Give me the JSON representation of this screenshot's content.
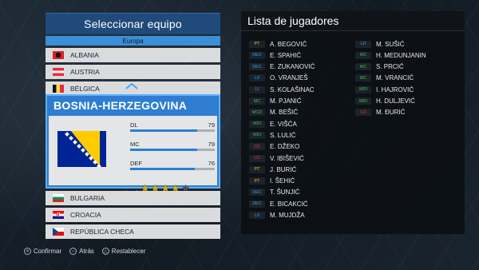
{
  "left_panel": {
    "title": "Seleccionar equipo",
    "region": "Europa",
    "countries_top": [
      "ALBANIA",
      "AUSTRIA",
      "BÉLGICA"
    ],
    "selected": {
      "name": "BOSNIA-HERZEGOVINA",
      "stats": [
        {
          "label": "DL",
          "value": "79",
          "fill": 79
        },
        {
          "label": "MC",
          "value": "79",
          "fill": 79
        },
        {
          "label": "DEF",
          "value": "76",
          "fill": 76
        }
      ],
      "stars": 4,
      "stars_max": 5
    },
    "countries_bottom": [
      "BULGARIA",
      "CROACIA",
      "REPÚBLICA CHECA"
    ]
  },
  "legend": {
    "confirm": "Confirmar",
    "back": "Atrás",
    "reset": "Restablecer"
  },
  "right_panel": {
    "title": "Lista de jugadores",
    "players_col1": [
      {
        "pos": "PT",
        "name": "A. BEGOVIĆ"
      },
      {
        "pos": "DEC",
        "name": "E. SPAHIĆ"
      },
      {
        "pos": "DEC",
        "name": "E. ZUKANOVIĆ"
      },
      {
        "pos": "LD",
        "name": "O. VRANJEŠ"
      },
      {
        "pos": "LI",
        "name": "S. KOLAŠINAC"
      },
      {
        "pos": "MC",
        "name": "M. PJANIĆ"
      },
      {
        "pos": "MCD",
        "name": "M. BEŠIĆ"
      },
      {
        "pos": "MDI",
        "name": "E. VIŠĆA"
      },
      {
        "pos": "MDI",
        "name": "S. LULIĆ"
      },
      {
        "pos": "CD",
        "name": "E. DŽEKO"
      },
      {
        "pos": "CD",
        "name": "V. IBIŠEVIĆ"
      },
      {
        "pos": "PT",
        "name": "J. BURIĆ"
      },
      {
        "pos": "PT",
        "name": "I. ŠEHIĆ"
      },
      {
        "pos": "DEC",
        "name": "T. ŠUNJIĆ"
      },
      {
        "pos": "DEC",
        "name": "E. BICAKCIĆ"
      },
      {
        "pos": "LD",
        "name": "M. MUJDŽA"
      }
    ],
    "players_col2": [
      {
        "pos": "LD",
        "name": "M. SUŠIĆ"
      },
      {
        "pos": "MC",
        "name": "H. MEDUNJANIN"
      },
      {
        "pos": "MC",
        "name": "S. PRCIĆ"
      },
      {
        "pos": "MC",
        "name": "M. VRANCIĆ"
      },
      {
        "pos": "MDI",
        "name": "I. HAJROVIĆ"
      },
      {
        "pos": "MDI",
        "name": "H. DULJEVIĆ"
      },
      {
        "pos": "CD",
        "name": "M. ĐURIĆ"
      }
    ]
  }
}
